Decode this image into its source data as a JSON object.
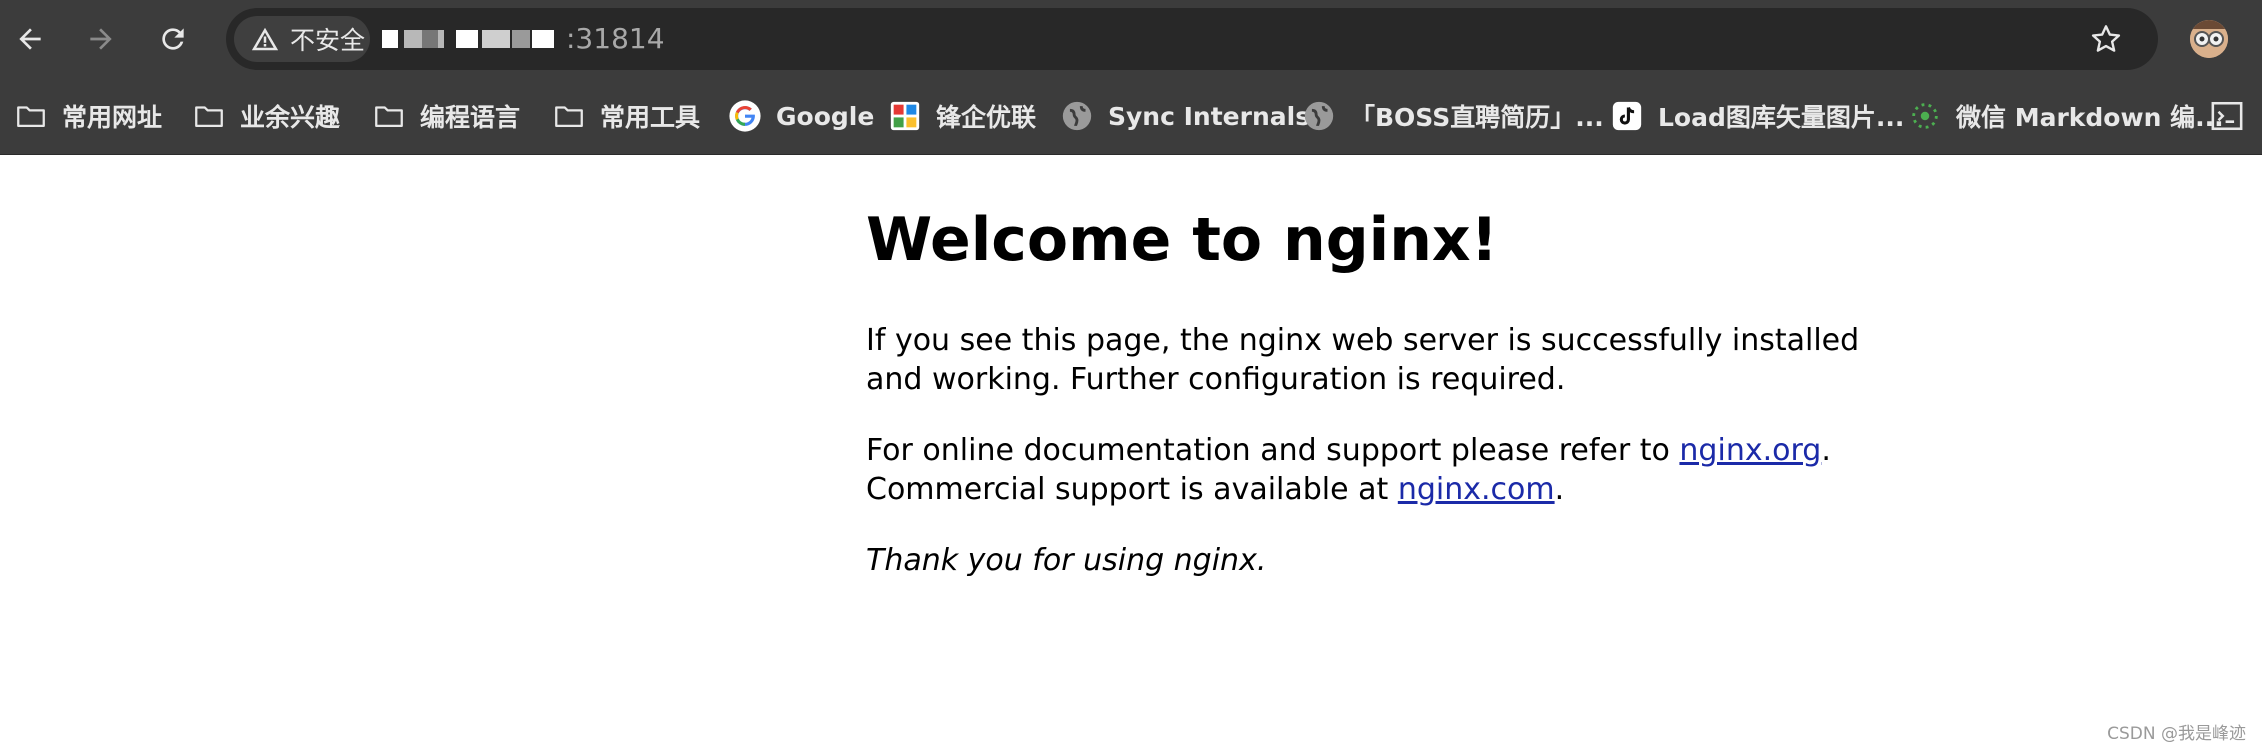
{
  "toolbar": {
    "security_label": "不安全",
    "url_port": ":31814",
    "back_icon": "arrow-left-icon",
    "forward_icon": "arrow-right-icon",
    "reload_icon": "reload-icon",
    "star_icon": "star-outline-icon"
  },
  "bookmarks": [
    {
      "label": "常用网址",
      "icon": "folder-icon"
    },
    {
      "label": "业余兴趣",
      "icon": "folder-icon"
    },
    {
      "label": "编程语言",
      "icon": "folder-icon"
    },
    {
      "label": "常用工具",
      "icon": "folder-icon"
    },
    {
      "label": "Google",
      "icon": "google-icon"
    },
    {
      "label": "锋企优联",
      "icon": "site-logo-icon"
    },
    {
      "label": "Sync Internals",
      "icon": "globe-icon"
    },
    {
      "label": "「BOSS直聘简历」...",
      "icon": "globe-icon"
    },
    {
      "label": "Load图库矢量图片...",
      "icon": "tiktok-icon"
    },
    {
      "label": "微信 Markdown 编...",
      "icon": "dotted-circle-icon"
    },
    {
      "label": "",
      "icon": "terminal-icon"
    }
  ],
  "page": {
    "heading": "Welcome to nginx!",
    "para1": "If you see this page, the nginx web server is successfully installed and working. Further configuration is required.",
    "para2_text1": "For online documentation and support please refer to ",
    "para2_link1": "nginx.org",
    "para2_text2": ".",
    "para2_text3": "Commercial support is available at ",
    "para2_link2": "nginx.com",
    "para2_text4": ".",
    "para3": "Thank you for using nginx."
  },
  "watermark": "CSDN @我是峰迹",
  "colors": {
    "toolbar_bg": "#3c3c3c",
    "omnibox_bg": "#282828",
    "link": "#1b2aa8"
  }
}
